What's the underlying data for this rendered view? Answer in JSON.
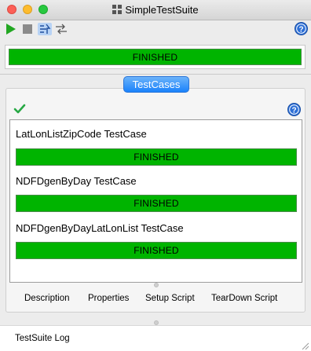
{
  "window": {
    "title": "SimpleTestSuite"
  },
  "toolbar": {
    "run_icon": "run-icon",
    "stop_icon": "stop-icon",
    "toggle_icon": "parallel-toggle-icon",
    "sequence_icon": "sequence-icon",
    "help_icon": "help-icon"
  },
  "suite": {
    "status": "FINISHED"
  },
  "testcases_tab": {
    "label": "TestCases"
  },
  "test_cases": [
    {
      "name": "LatLonListZipCode TestCase",
      "status": "FINISHED"
    },
    {
      "name": "NDFDgenByDay TestCase",
      "status": "FINISHED"
    },
    {
      "name": "NDFDgenByDayLatLonList TestCase",
      "status": "FINISHED"
    }
  ],
  "bottom_tabs": {
    "description": "Description",
    "properties": "Properties",
    "setup_script": "Setup Script",
    "teardown_script": "TearDown Script"
  },
  "log": {
    "label": "TestSuite Log"
  },
  "colors": {
    "progress_green": "#00b400",
    "tab_blue": "#1a82fb",
    "check_green": "#27a844"
  }
}
